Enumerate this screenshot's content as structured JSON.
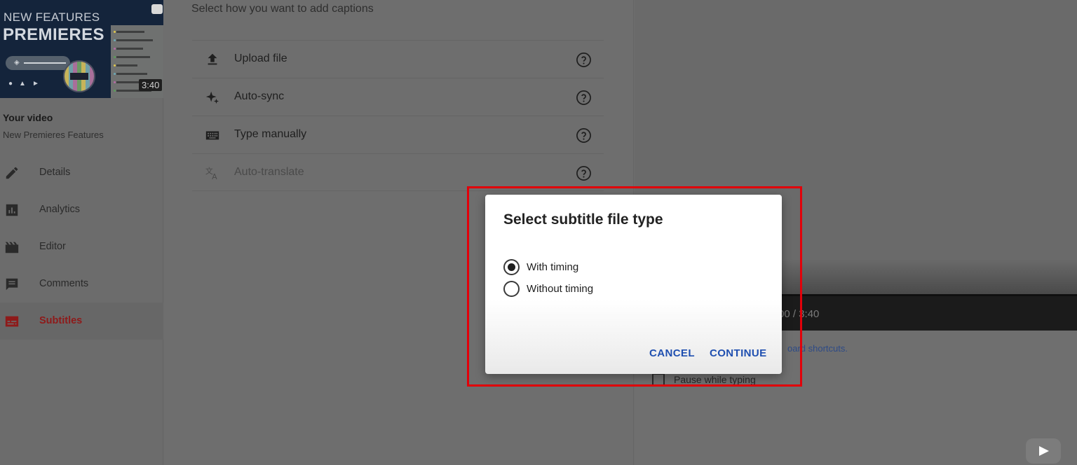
{
  "sidebar": {
    "thumbnail": {
      "title_line_1": "NEW FEATURES",
      "title_line_2": "PREMIERES",
      "duration": "3:40"
    },
    "your_video_label": "Your video",
    "video_name": "New Premieres Features",
    "items": [
      {
        "label": "Details",
        "icon": "pencil-icon"
      },
      {
        "label": "Analytics",
        "icon": "analytics-icon"
      },
      {
        "label": "Editor",
        "icon": "clapperboard-icon"
      },
      {
        "label": "Comments",
        "icon": "comment-icon"
      },
      {
        "label": "Subtitles",
        "icon": "subtitles-icon",
        "active": true
      }
    ]
  },
  "captions": {
    "heading": "Select how you want to add captions",
    "options": [
      {
        "label": "Upload file",
        "icon": "upload-icon"
      },
      {
        "label": "Auto-sync",
        "icon": "sparkle-icon"
      },
      {
        "label": "Type manually",
        "icon": "keyboard-icon"
      },
      {
        "label": "Auto-translate",
        "icon": "translate-icon",
        "disabled": true
      }
    ]
  },
  "player": {
    "time": "00 / 3:40",
    "shortcuts_link": "oard shortcuts.",
    "pause_label": "Pause while typing"
  },
  "dialog": {
    "title": "Select subtitle file type",
    "options": [
      {
        "label": "With timing",
        "checked": true
      },
      {
        "label": "Without timing",
        "checked": false
      }
    ],
    "cancel_label": "CANCEL",
    "continue_label": "CONTINUE"
  },
  "colors": {
    "highlight": "#e2000a",
    "accent_button": "#1f4fb0",
    "active_nav": "#8e1a1a"
  }
}
